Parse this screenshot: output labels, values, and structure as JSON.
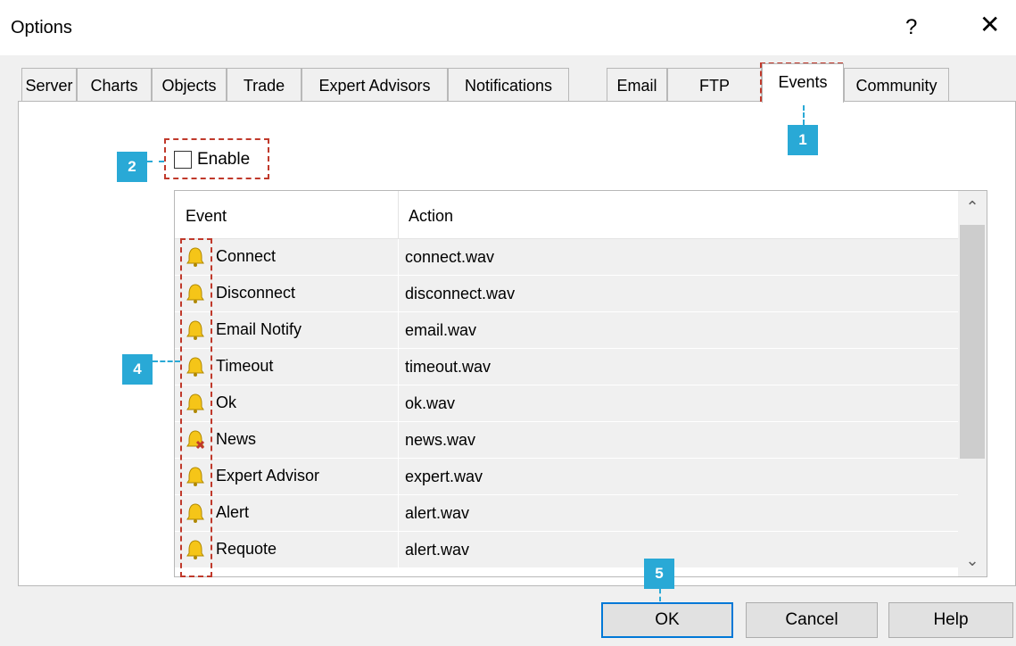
{
  "window": {
    "title": "Options",
    "help_glyph": "?",
    "close_glyph": "✕"
  },
  "tabs": [
    {
      "label": "Server"
    },
    {
      "label": "Charts"
    },
    {
      "label": "Objects"
    },
    {
      "label": "Trade"
    },
    {
      "label": "Expert Advisors"
    },
    {
      "label": "Notifications"
    },
    {
      "label": "Email"
    },
    {
      "label": "FTP"
    },
    {
      "label": "Events",
      "active": true
    },
    {
      "label": "Community"
    }
  ],
  "enable": {
    "label": "Enable",
    "checked": false
  },
  "table": {
    "headers": {
      "event": "Event",
      "action": "Action"
    },
    "rows": [
      {
        "event": "Connect",
        "action": "connect.wav",
        "icon": "bell-icon"
      },
      {
        "event": "Disconnect",
        "action": "disconnect.wav",
        "icon": "bell-icon"
      },
      {
        "event": "Email Notify",
        "action": "email.wav",
        "icon": "bell-icon"
      },
      {
        "event": "Timeout",
        "action": "timeout.wav",
        "icon": "bell-icon"
      },
      {
        "event": "Ok",
        "action": "ok.wav",
        "icon": "bell-icon"
      },
      {
        "event": "News",
        "action": "news.wav",
        "icon": "bell-disabled-icon"
      },
      {
        "event": "Expert Advisor",
        "action": "expert.wav",
        "icon": "bell-icon"
      },
      {
        "event": "Alert",
        "action": "alert.wav",
        "icon": "bell-icon"
      },
      {
        "event": "Requote",
        "action": "alert.wav",
        "icon": "bell-icon"
      }
    ]
  },
  "scrollbar": {
    "up_glyph": "⌃",
    "down_glyph": "⌄"
  },
  "buttons": {
    "ok": "OK",
    "cancel": "Cancel",
    "help": "Help"
  },
  "callouts": [
    "1",
    "2",
    "4",
    "5"
  ],
  "colors": {
    "callout": "#29a9d6",
    "highlight": "#c0392b",
    "focus_border": "#0078d7",
    "bell": "#f5c518"
  }
}
